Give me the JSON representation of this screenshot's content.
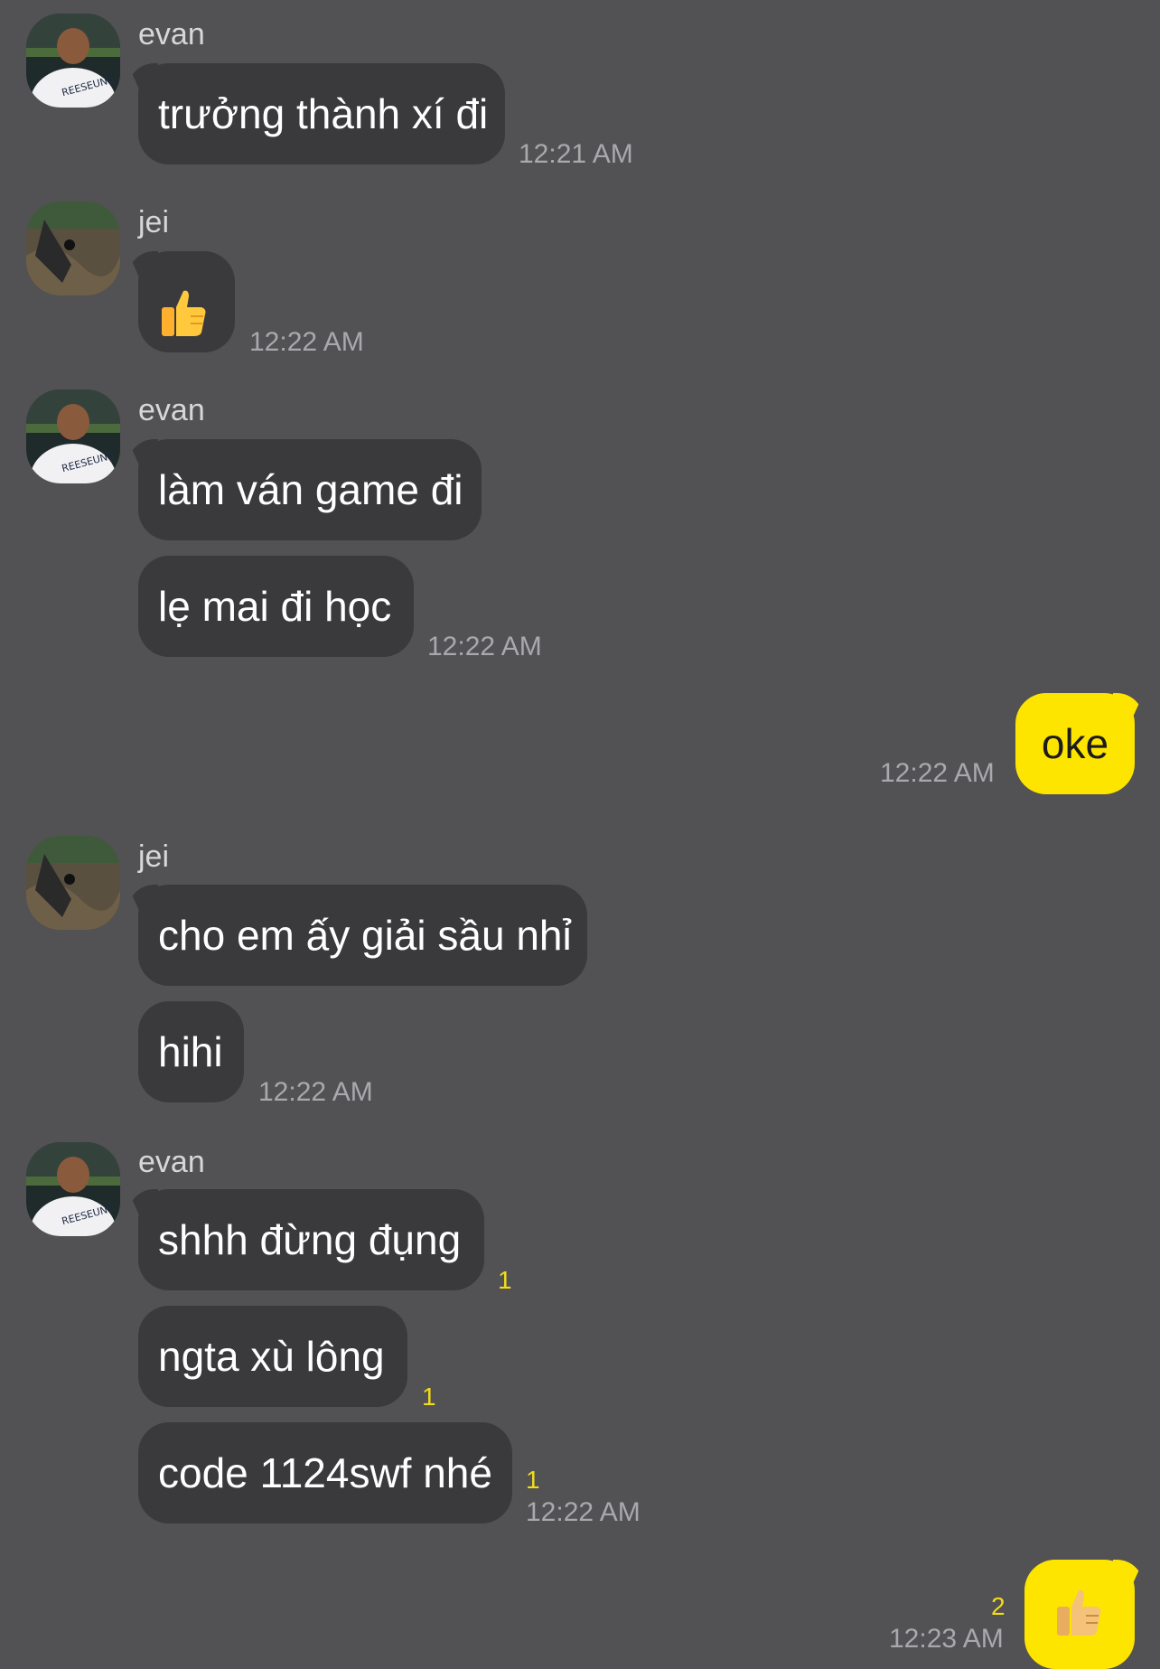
{
  "colors": {
    "background": "#525153",
    "incoming_bubble": "#3a3a3c",
    "outgoing_bubble": "#fee500",
    "unread_count": "#f2dc1a"
  },
  "groups": [
    {
      "sender": "evan",
      "messages": [
        "trưởng thành xí đi"
      ],
      "time": "12:21 AM"
    },
    {
      "sender": "jei",
      "messages": [
        "thumbs-up-emoji"
      ],
      "time": "12:22 AM"
    },
    {
      "sender": "evan",
      "messages": [
        "làm ván game đi",
        "lẹ mai đi học"
      ],
      "time": "12:22 AM"
    },
    {
      "outgoing": true,
      "message": "oke",
      "time": "12:22 AM"
    },
    {
      "sender": "jei",
      "messages": [
        "cho em ấy giải sầu nhỉ",
        "hihi"
      ],
      "time": "12:22 AM"
    },
    {
      "sender": "evan",
      "messages": [
        "shhh đừng đụng",
        "ngta xù lông",
        "code 1124swf nhé"
      ],
      "unread": [
        "1",
        "1",
        "1"
      ],
      "time": "12:22 AM"
    },
    {
      "outgoing": true,
      "message": "thumbs-up-emoji",
      "unread": "2",
      "time": "12:23 AM"
    }
  ]
}
